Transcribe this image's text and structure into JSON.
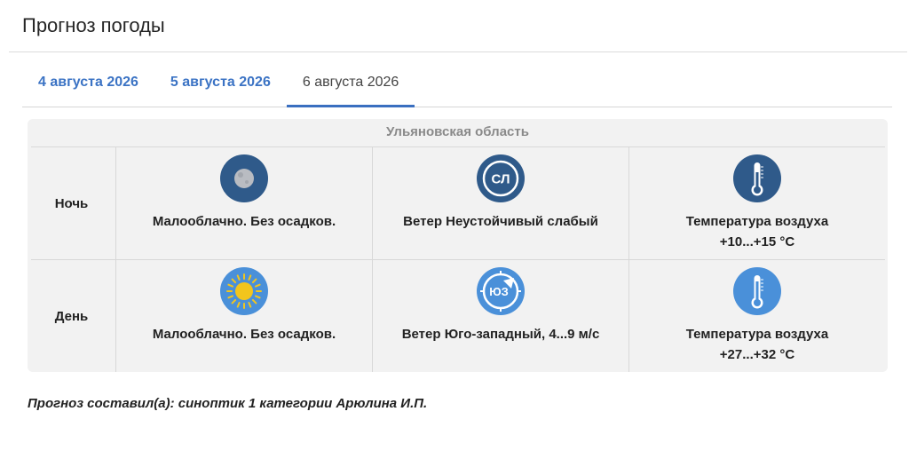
{
  "page": {
    "title": "Прогноз погоды"
  },
  "tabs": [
    {
      "label": "4 августа 2026",
      "active": false
    },
    {
      "label": "5 августа 2026",
      "active": false
    },
    {
      "label": "6 августа 2026",
      "active": true
    }
  ],
  "forecast": {
    "region": "Ульяновская область",
    "rows": [
      {
        "period": "Ночь",
        "sky": {
          "icon": "moon-icon",
          "text": "Малооблачно. Без осадков."
        },
        "wind": {
          "icon": "wind-variable-icon",
          "badge": "СЛ",
          "text": "Ветер Неустойчивый слабый"
        },
        "temp": {
          "icon": "thermometer-icon",
          "label": "Температура воздуха",
          "value": "+10...+15 °С"
        }
      },
      {
        "period": "День",
        "sky": {
          "icon": "sun-icon",
          "text": "Малооблачно. Без осадков."
        },
        "wind": {
          "icon": "wind-direction-icon",
          "badge": "ЮЗ",
          "text": "Ветер Юго-западный, 4...9 м/с"
        },
        "temp": {
          "icon": "thermometer-icon",
          "label": "Температура воздуха",
          "value": "+27...+32 °С"
        }
      }
    ]
  },
  "footer": {
    "author": "Прогноз составил(а): синоптик 1 категории Арюлина И.П."
  },
  "colors": {
    "accent": "#3b73c4",
    "night_icon": "#2f5a8a",
    "day_icon": "#4a90d9",
    "sun": "#f2c51c"
  }
}
